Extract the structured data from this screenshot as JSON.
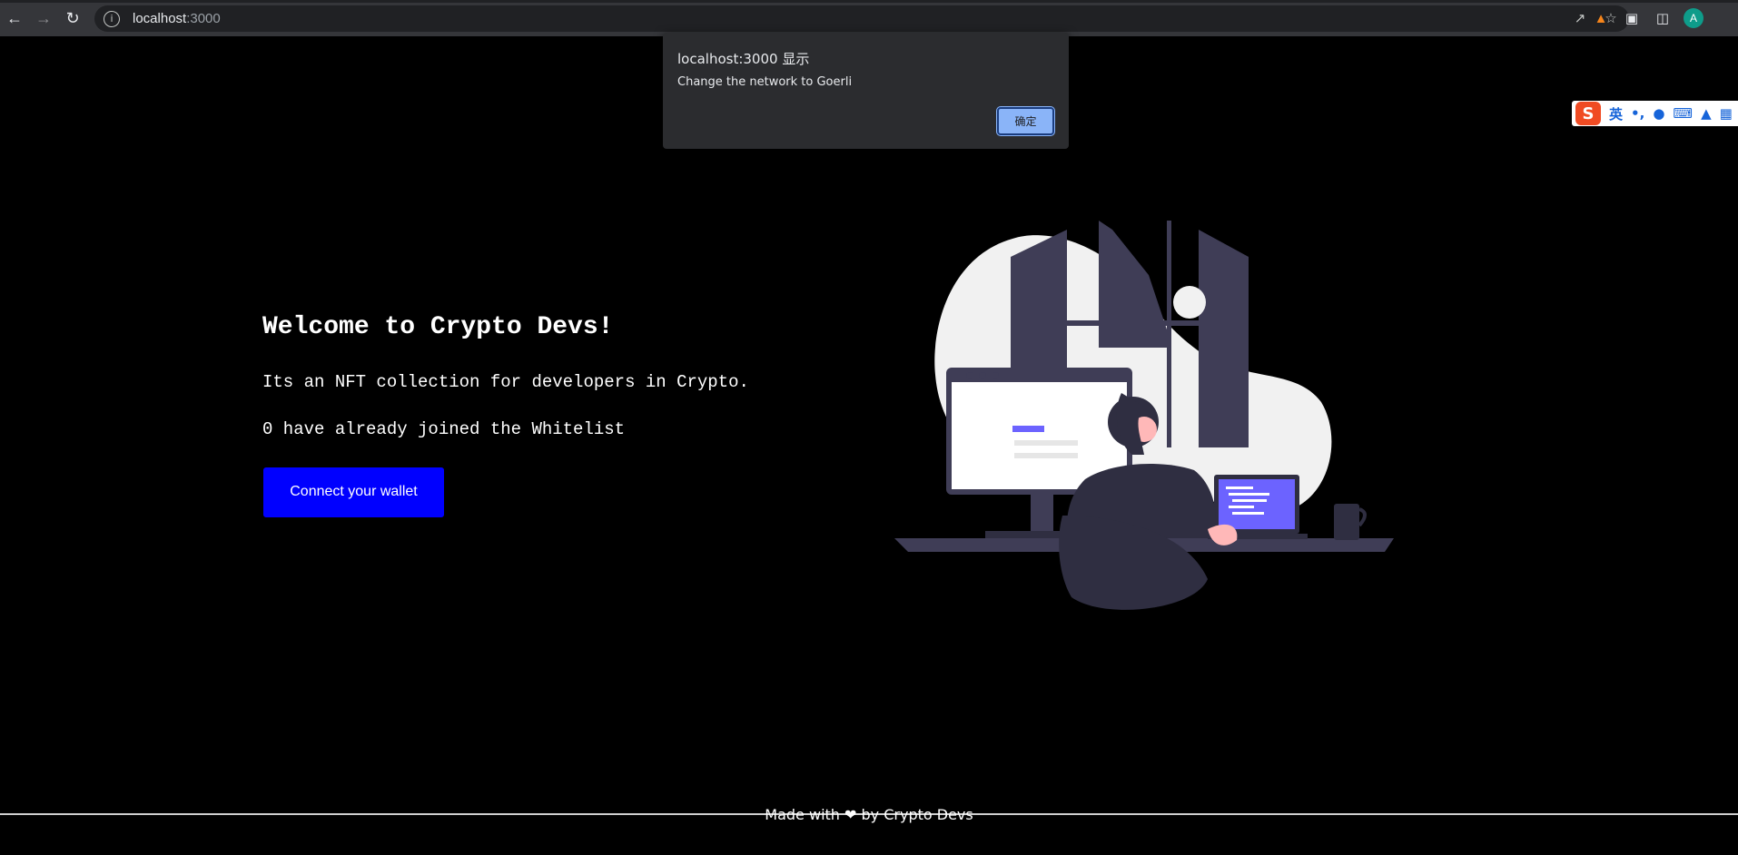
{
  "browser": {
    "url_host": "localhost",
    "url_port": ":3000",
    "avatar_letter": "A",
    "icons": {
      "back": "back-arrow-icon",
      "forward": "forward-arrow-icon",
      "reload": "reload-icon",
      "info": "info-icon",
      "share": "share-icon",
      "bookmark": "star-icon",
      "metamask": "metamask-fox-icon",
      "extensions": "puzzle-icon",
      "sidepanel": "side-panel-icon"
    }
  },
  "dialog": {
    "title": "localhost:3000 显示",
    "message": "Change the network to Goerli",
    "ok_label": "确定"
  },
  "ime": {
    "logo": "S",
    "lang": "英",
    "punct": "•,",
    "icons": [
      "microphone-icon",
      "keyboard-icon",
      "shirt-icon",
      "grid-icon"
    ]
  },
  "hero": {
    "title": "Welcome to Crypto Devs!",
    "description": "Its an NFT collection for developers in Crypto.",
    "count_text": "0 have already joined the Whitelist",
    "button_label": "Connect your wallet",
    "button_color": "#0000ff"
  },
  "footer": {
    "text_before": "Made with",
    "heart": "❤",
    "text_after": "by Crypto Devs"
  }
}
